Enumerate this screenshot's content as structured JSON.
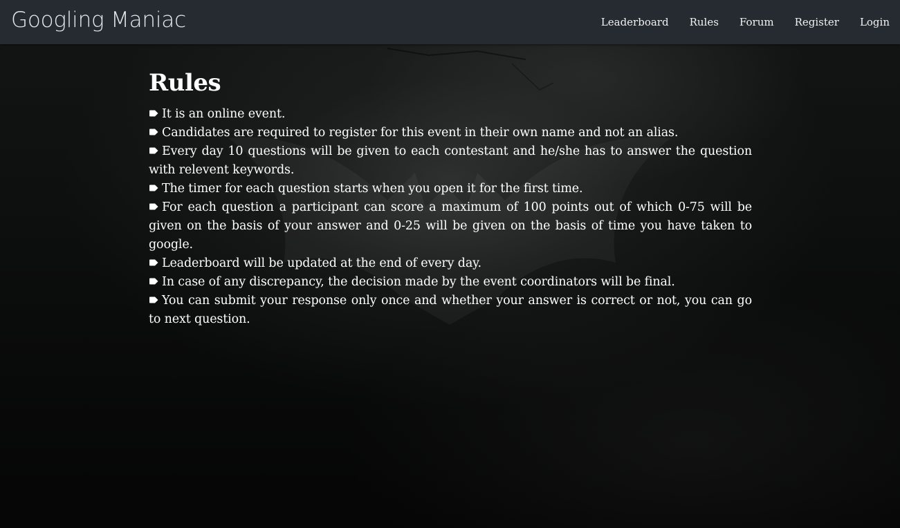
{
  "navbar": {
    "brand": "Googling Maniac",
    "links": [
      "Leaderboard",
      "Rules",
      "Forum",
      "Register",
      "Login"
    ]
  },
  "page": {
    "title": "Rules",
    "bullet_icon": "pointing-tag-icon",
    "rules": [
      "It is an online event.",
      "Candidates are required to register for this event in their own name and not an alias.",
      "Every day 10 questions will be given to each contestant and he/she has to answer the question with relevent keywords.",
      "The timer for each question starts when you open it for the first time.",
      "For each question a participant can score a maximum of 100 points out of which 0-75 will be given on the basis of your answer and 0-25 will be given on the basis of time you have taken to google.",
      "Leaderboard will be updated at the end of every day.",
      "In case of any discrepancy, the decision made by the event coordinators will be final.",
      "You can submit your response only once and whether your answer is correct or not, you can go to next question."
    ]
  },
  "colors": {
    "navbar_bg": "#252b30",
    "page_bg": "#050505",
    "text": "#ffffff"
  }
}
